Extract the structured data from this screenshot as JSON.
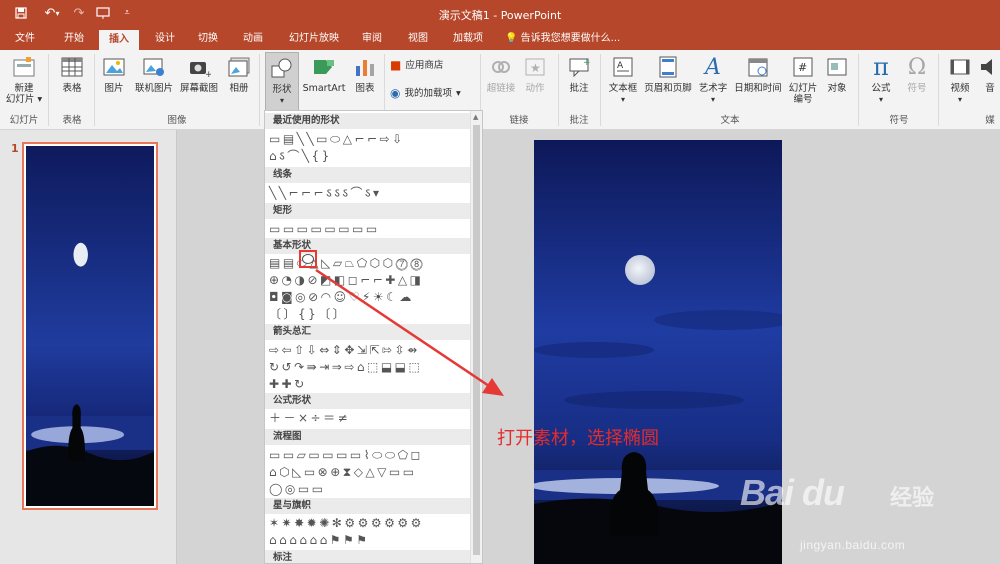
{
  "titlebar": {
    "title": "演示文稿1 - PowerPoint"
  },
  "quick_access": {
    "save_icon": "save-icon",
    "undo_icon": "undo-icon",
    "redo_icon": "redo-icon",
    "present_icon": "present-icon",
    "customize_icon": "customize-icon"
  },
  "tabs": [
    "文件",
    "开始",
    "插入",
    "设计",
    "切换",
    "动画",
    "幻灯片放映",
    "审阅",
    "视图",
    "加载项"
  ],
  "active_tab": "插入",
  "tell_me": "告诉我您想要做什么...",
  "ribbon": {
    "new_slide": "新建\n幻灯片 ▾",
    "table": "表格",
    "picture": "图片",
    "online_picture": "联机图片",
    "screenshot": "屏幕截图",
    "album": "相册",
    "shapes": "形状",
    "smartart": "SmartArt",
    "chart": "图表",
    "app_store": "应用商店",
    "my_addins": "我的加载项",
    "hyperlink": "超链接",
    "action": "动作",
    "comment": "批注",
    "text_box": "文本框",
    "header_footer": "页眉和页脚",
    "wordart": "艺术字",
    "date_time": "日期和时间",
    "slide_number": "幻灯片\n编号",
    "object": "对象",
    "equation": "公式",
    "symbol": "符号",
    "video": "视频",
    "audio": "音",
    "groups": {
      "slides": "幻灯片",
      "tables": "表格",
      "images": "图像",
      "links": "链接",
      "comments": "批注",
      "text": "文本",
      "symbols": "符号",
      "media": "媒"
    }
  },
  "slide_pane": {
    "slide_number": "1"
  },
  "gallery": {
    "categories": [
      "最近使用的形状",
      "线条",
      "矩形",
      "基本形状",
      "箭头总汇",
      "公式形状",
      "流程图",
      "星与旗帜",
      "标注"
    ],
    "rows": {
      "recent1": "▭▤╲╲▭⬭△⌐⌐⇨⇩",
      "recent2": "⌂ऽ⌒╲{}",
      "lines": "╲╲⌐⌐⌐ऽऽऽ⌒ऽ▾",
      "rects": "▭▭▭▭▭▭▭▭",
      "basic1": "▤▤⬭△◺▱⏢⬠⬡⬡⓻⓼",
      "basic2": "⊕◔◑⊘◩◧◻⌐⌐✚△◨",
      "basic3": "◘◙◎⊘◠☺♡⚡☀☾☁",
      "basic4": "〔〕{}〔〕",
      "arrows1": "⇨⇦⇧⇩⇔⇕✥⇲⇱⇰⇳⇴",
      "arrows2": "↻↺↷⇛⇥⇒⇨⌂⬚⬓⬓⬚",
      "arrows3": "✚✚↻",
      "equation": "＋－×÷＝≠",
      "flow1": "▭▭▱▭▭▭▭⌇⬭⬭⬠◻",
      "flow2": "⌂⬡◺▭⊗⊕⧗◇△▽▭▭",
      "flow3": "◯◎▭▭",
      "stars1": "✶✷✸✹✺✻⚙⚙⚙⚙⚙⚙",
      "stars2": "⌂⌂⌂⌂⌂⌂⚑⚑⚑"
    }
  },
  "annotation": "打开素材，选择椭圆",
  "watermark": {
    "logo": "Bai du",
    "brand": "经验",
    "url": "jingyan.baidu.com"
  },
  "colors": {
    "accent": "#b7472a",
    "ribbon_bg": "#f3f3f3",
    "highlight": "#e53935",
    "annotation": "#e32c2c"
  }
}
